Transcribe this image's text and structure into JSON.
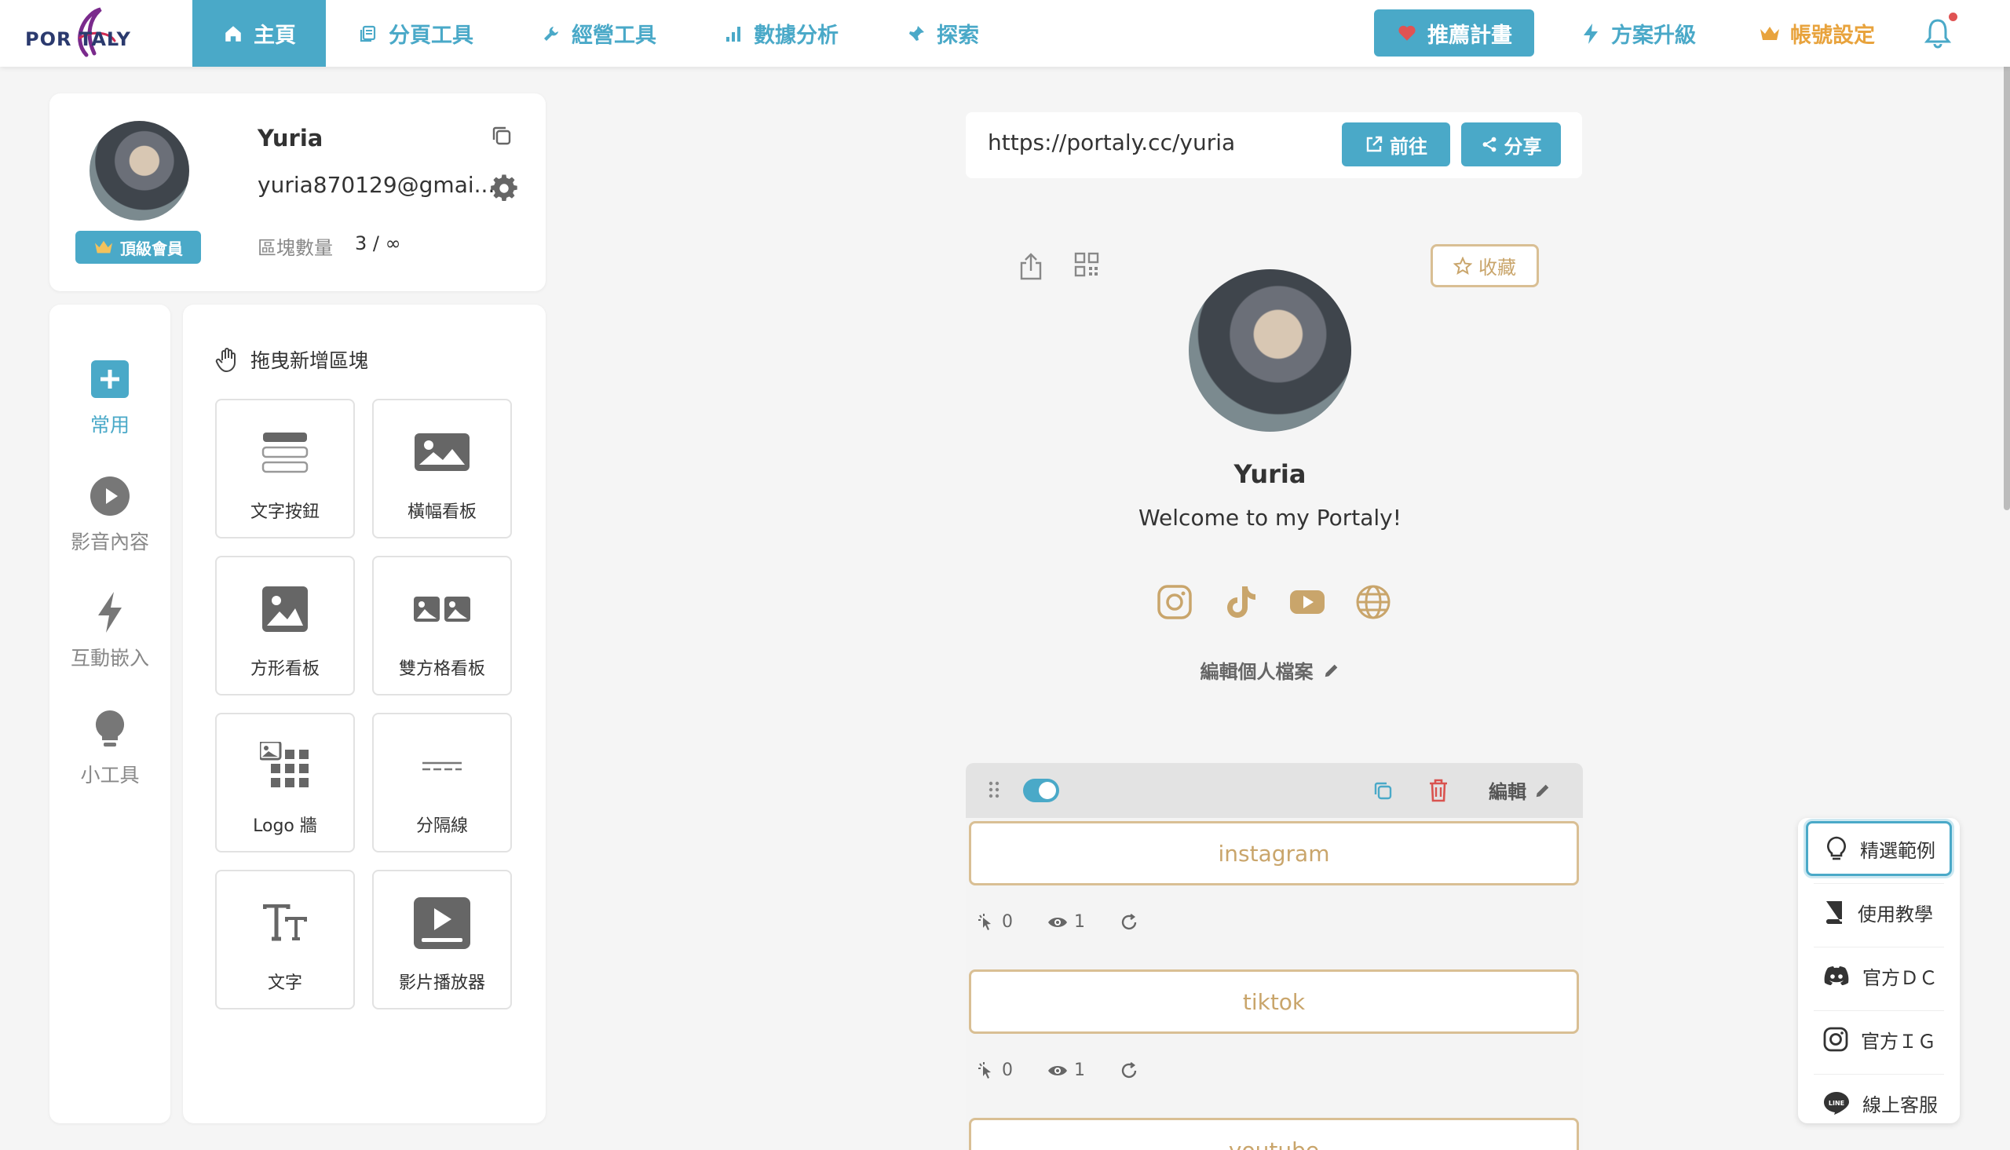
{
  "logo": {
    "text": "POR TALY"
  },
  "nav": {
    "home": "主頁",
    "page_tools": "分頁工具",
    "biz_tools": "經營工具",
    "analytics": "數據分析",
    "explore": "探索",
    "referral": "推薦計畫",
    "upgrade": "方案升級",
    "account": "帳號設定"
  },
  "profile": {
    "name": "Yuria",
    "email": "yuria870129@gmai...",
    "badge": "頂級會員",
    "blocks_label": "區塊數量",
    "blocks_value": "3 / ∞"
  },
  "rail": [
    {
      "label": "常用",
      "icon": "plus-square-icon"
    },
    {
      "label": "影音內容",
      "icon": "play-circle-icon"
    },
    {
      "label": "互動嵌入",
      "icon": "bolt-icon"
    },
    {
      "label": "小工具",
      "icon": "bulb-icon"
    }
  ],
  "blocks_panel": {
    "title": "拖曳新增區塊",
    "tiles": [
      {
        "label": "文字按鈕",
        "icon": "text-button-icon"
      },
      {
        "label": "橫幅看板",
        "icon": "banner-image-icon"
      },
      {
        "label": "方形看板",
        "icon": "square-image-icon"
      },
      {
        "label": "雙方格看板",
        "icon": "double-image-icon"
      },
      {
        "label": "Logo 牆",
        "icon": "logo-wall-icon"
      },
      {
        "label": "分隔線",
        "icon": "divider-icon"
      },
      {
        "label": "文字",
        "icon": "text-icon"
      },
      {
        "label": "影片播放器",
        "icon": "video-player-icon"
      }
    ]
  },
  "preview": {
    "url": "https://portaly.cc/yuria",
    "go_label": "前往",
    "share_label": "分享",
    "fav_label": "收藏",
    "name": "Yuria",
    "bio": "Welcome to my Portaly!",
    "edit_profile": "編輯個人檔案"
  },
  "editor": {
    "edit_label": "編輯",
    "links": [
      {
        "label": "instagram",
        "clicks": "0",
        "views": "1"
      },
      {
        "label": "tiktok",
        "clicks": "0",
        "views": "1"
      },
      {
        "label": "youtube"
      }
    ]
  },
  "help": [
    {
      "label": "精選範例",
      "icon": "bulb-outline-icon"
    },
    {
      "label": "使用教學",
      "icon": "book-icon"
    },
    {
      "label": "官方ＤＣ",
      "icon": "discord-icon"
    },
    {
      "label": "官方ＩＧ",
      "icon": "instagram-icon"
    },
    {
      "label": "線上客服",
      "icon": "line-icon"
    }
  ],
  "colors": {
    "accent": "#4aa9c8",
    "gold": "#d9bf94",
    "orange": "#e8a33d",
    "danger": "#e05353"
  }
}
